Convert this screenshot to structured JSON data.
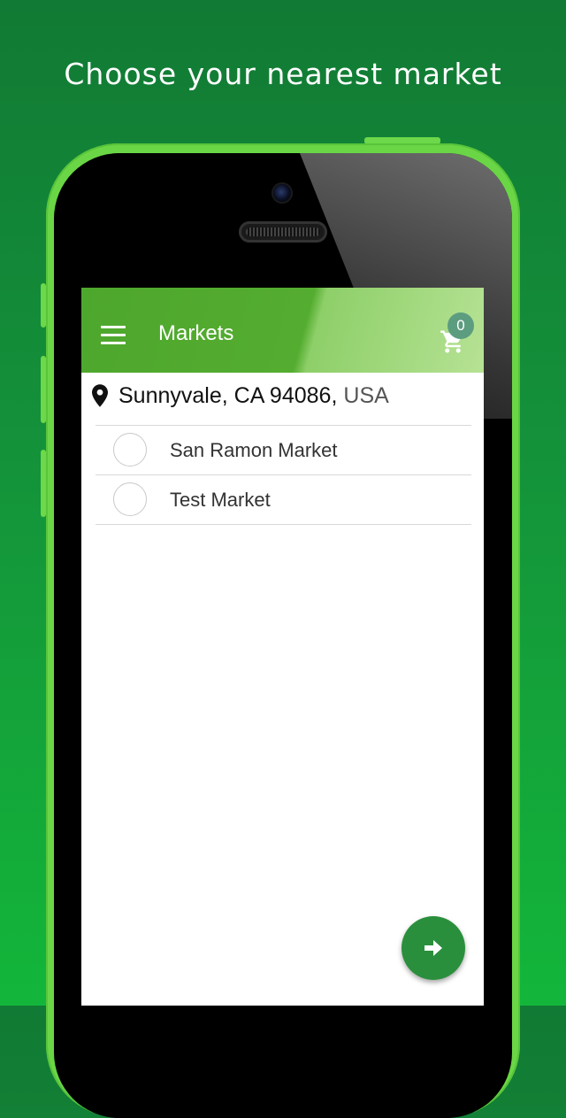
{
  "headline": "Choose your nearest market",
  "app_bar": {
    "title": "Markets",
    "cart_count": "0",
    "background_color": "#4ea72d"
  },
  "location": {
    "address": "Sunnyvale, CA 94086,",
    "country": "USA"
  },
  "markets": [
    {
      "name": "San Ramon Market",
      "selected": false
    },
    {
      "name": "Test Market",
      "selected": false
    }
  ],
  "icons": {
    "menu": "hamburger-menu-icon",
    "cart": "shopping-cart-icon",
    "location": "map-pin-icon",
    "next": "arrow-right-icon"
  },
  "colors": {
    "background_top": "#117a34",
    "background_bottom": "#13b63a",
    "phone_body": "#6ad646",
    "fab": "#2a8f3c",
    "badge": "#5c9d80"
  }
}
